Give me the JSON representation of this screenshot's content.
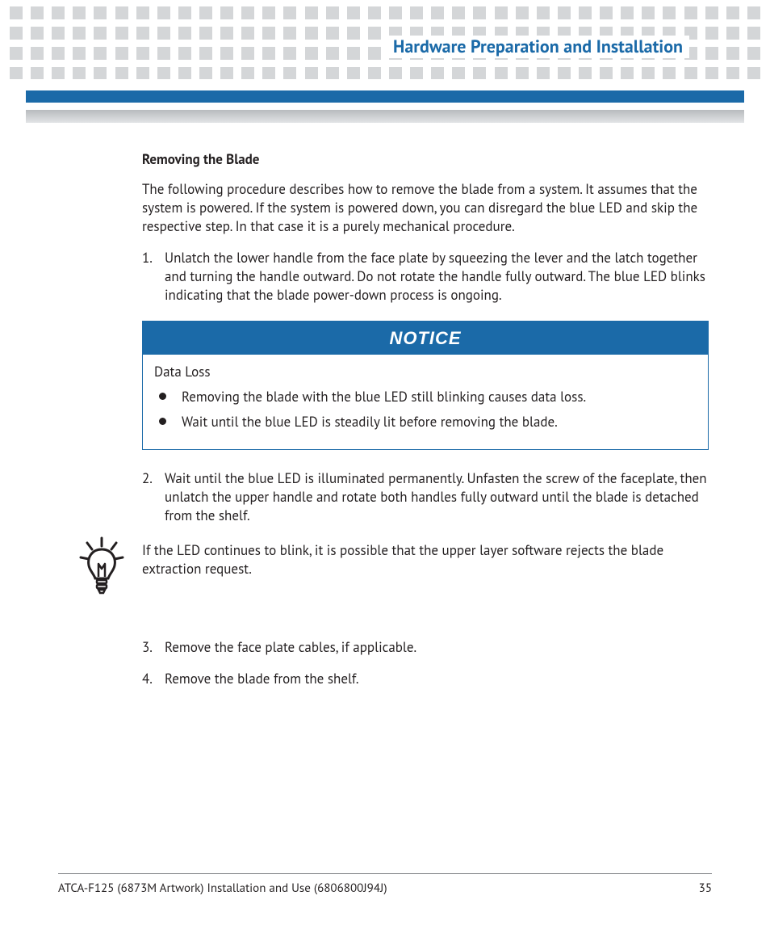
{
  "header": {
    "chapter_title": "Hardware Preparation and Installation"
  },
  "content": {
    "subheading": "Removing the Blade",
    "intro": "The following procedure describes how to remove the blade from a system. It assumes that the system is powered. If the system is powered down, you can disregard the blue LED and skip the respective step. In that case it is a purely mechanical procedure.",
    "step1": "Unlatch the lower handle from the face plate by squeezing the lever and the latch together and turning the handle outward. Do not rotate the handle fully outward. The blue LED blinks indicating that the blade power-down process is ongoing.",
    "notice": {
      "banner": "NOTICE",
      "label": "Data Loss",
      "items": [
        "Removing the blade with the blue LED still blinking causes data loss.",
        "Wait until the blue LED is steadily lit before removing the blade."
      ]
    },
    "step2": "Wait until the blue LED is illuminated permanently. Unfasten the screw of the faceplate, then unlatch the upper handle and rotate both handles fully outward until the blade is detached from the shelf.",
    "tip": "If the LED continues to blink, it is possible that the upper layer software rejects the blade extraction request.",
    "step3": "Remove the face plate cables, if applicable.",
    "step4": "Remove the blade from the shelf."
  },
  "footer": {
    "doc_title": "ATCA-F125 (6873M Artwork) Installation and Use (6806800J94J)",
    "page_number": "35"
  }
}
